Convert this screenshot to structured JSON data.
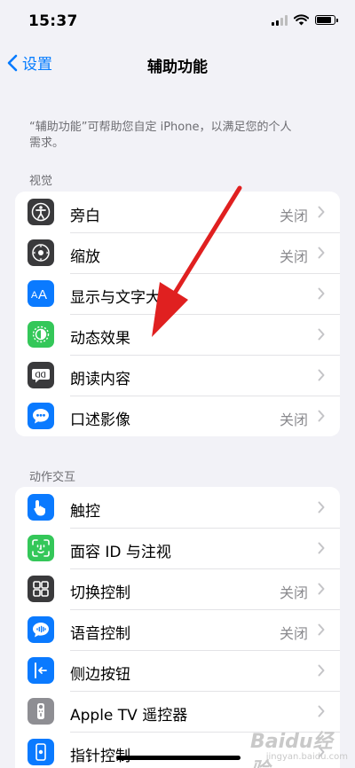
{
  "status": {
    "time": "15:37"
  },
  "nav": {
    "back_label": "设置",
    "title": "辅助功能"
  },
  "description": "“辅助功能”可帮助您自定 iPhone，以满足您的个人需求。",
  "sections": [
    {
      "header": "视觉",
      "items": [
        {
          "label": "旁白",
          "value": "关闭",
          "icon": "voiceover-icon"
        },
        {
          "label": "缩放",
          "value": "关闭",
          "icon": "zoom-icon"
        },
        {
          "label": "显示与文字大小",
          "value": "",
          "icon": "text-size-icon"
        },
        {
          "label": "动态效果",
          "value": "",
          "icon": "motion-icon"
        },
        {
          "label": "朗读内容",
          "value": "",
          "icon": "spoken-content-icon"
        },
        {
          "label": "口述影像",
          "value": "关闭",
          "icon": "audio-descriptions-icon"
        }
      ]
    },
    {
      "header": "动作交互",
      "items": [
        {
          "label": "触控",
          "value": "",
          "icon": "touch-icon"
        },
        {
          "label": "面容 ID 与注视",
          "value": "",
          "icon": "face-id-icon"
        },
        {
          "label": "切换控制",
          "value": "关闭",
          "icon": "switch-control-icon"
        },
        {
          "label": "语音控制",
          "value": "关闭",
          "icon": "voice-control-icon"
        },
        {
          "label": "侧边按钮",
          "value": "",
          "icon": "side-button-icon"
        },
        {
          "label": "Apple TV 遥控器",
          "value": "",
          "icon": "apple-tv-remote-icon"
        },
        {
          "label": "指针控制",
          "value": "",
          "icon": "pointer-control-icon"
        }
      ]
    }
  ],
  "watermark": {
    "text": "Baidu经验",
    "sub": "jingyan.baidu.com"
  },
  "colors": {
    "accent": "#007aff",
    "annotation_arrow": "#e02020"
  }
}
